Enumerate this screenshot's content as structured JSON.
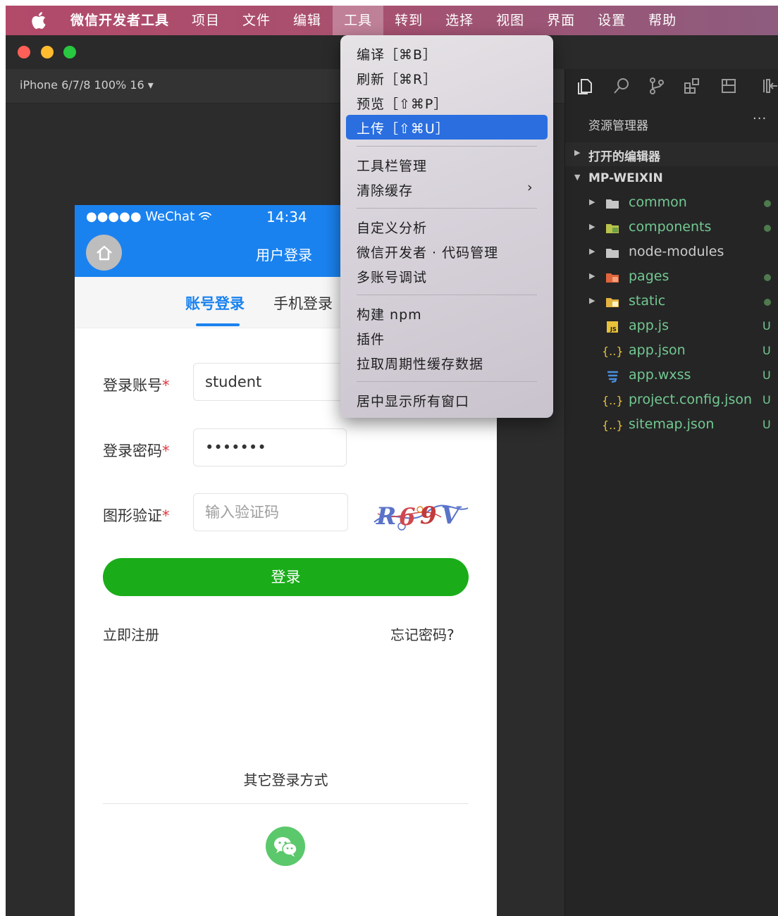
{
  "menubar": {
    "app_name": "微信开发者工具",
    "items": [
      "项目",
      "文件",
      "编辑",
      "工具",
      "转到",
      "选择",
      "视图",
      "界面",
      "设置",
      "帮助"
    ],
    "active_item": "工具"
  },
  "toolbar": {
    "device_selector": "iPhone 6/7/8 100% 16 ▾"
  },
  "phone": {
    "status_left": "●●●●● WeChat",
    "status_time": "14:34",
    "nav_title": "用户登录",
    "tabs": [
      "账号登录",
      "手机登录"
    ],
    "form": {
      "account_label": "登录账号",
      "account_value": "student",
      "password_label": "登录密码",
      "password_value": "•••••••",
      "captcha_label": "图形验证",
      "captcha_placeholder": "输入验证码",
      "captcha_text": "R69V",
      "required_mark": "*"
    },
    "login_button": "登录",
    "register_link": "立即注册",
    "forgot_link": "忘记密码?",
    "other_login_title": "其它登录方式"
  },
  "dropdown": {
    "items": [
      {
        "label": "编译［⌘B］"
      },
      {
        "label": "刷新［⌘R］"
      },
      {
        "label": "预览［⇧⌘P］"
      },
      {
        "label": "上传［⇧⌘U］",
        "selected": true
      },
      {
        "label": "工具栏管理"
      },
      {
        "label": "清除缓存",
        "submenu": true
      },
      {
        "label": "自定义分析"
      },
      {
        "label": "微信开发者 · 代码管理"
      },
      {
        "label": "多账号调试"
      },
      {
        "label": "构建 npm"
      },
      {
        "label": "插件"
      },
      {
        "label": "拉取周期性缓存数据"
      },
      {
        "label": "居中显示所有窗口"
      }
    ],
    "submenu_indicator": "›"
  },
  "explorer": {
    "title": "资源管理器",
    "more": "···",
    "sections": [
      "打开的编辑器",
      "MP-WEIXIN"
    ],
    "tree": [
      {
        "name": "common",
        "type": "folder",
        "status": "dot"
      },
      {
        "name": "components",
        "type": "folder",
        "status": "dot"
      },
      {
        "name": "node-modules",
        "type": "folder",
        "status": ""
      },
      {
        "name": "pages",
        "type": "folder",
        "status": "dot"
      },
      {
        "name": "static",
        "type": "folder",
        "status": "dot"
      },
      {
        "name": "app.js",
        "type": "js",
        "status": "U"
      },
      {
        "name": "app.json",
        "type": "json",
        "status": "U"
      },
      {
        "name": "app.wxss",
        "type": "css",
        "status": "U"
      },
      {
        "name": "project.config.json",
        "type": "json",
        "status": "U"
      },
      {
        "name": "sitemap.json",
        "type": "json",
        "status": "U"
      }
    ],
    "json_icon_glyph": "{..}",
    "js_icon_glyph": "JS"
  },
  "colors": {
    "menubar": "#b24a6a",
    "phone_header": "#1a82ef",
    "login_button": "#1aad19",
    "menu_selection": "#2a6ee0",
    "git_untracked": "#73c991"
  }
}
